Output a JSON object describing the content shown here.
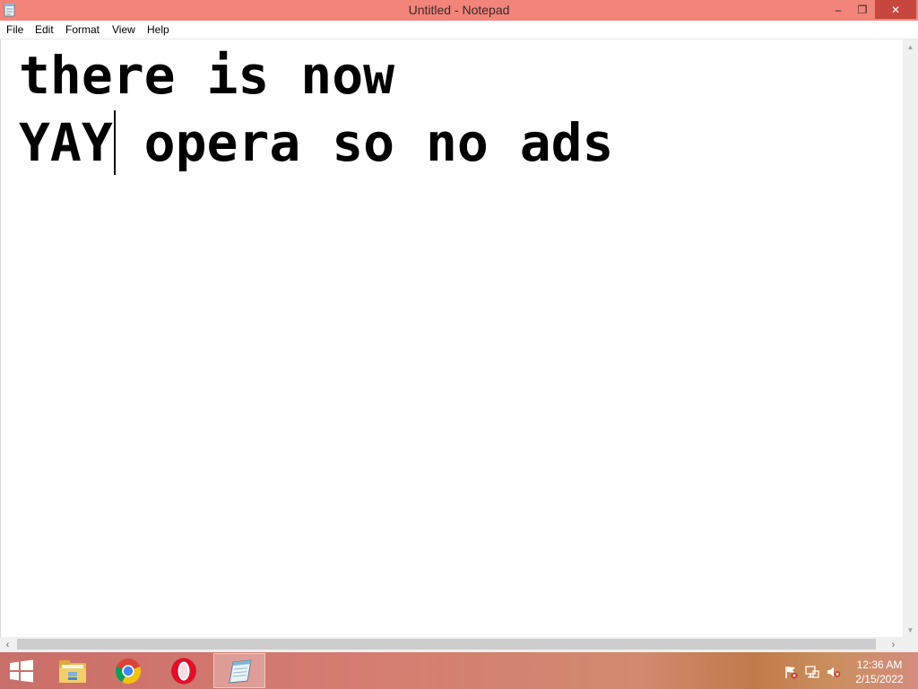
{
  "window": {
    "title": "Untitled - Notepad",
    "controls": {
      "minimize": "–",
      "maximize": "❐",
      "close": "✕"
    }
  },
  "menu": {
    "file": "File",
    "edit": "Edit",
    "format": "Format",
    "view": "View",
    "help": "Help"
  },
  "editor": {
    "line1": "there is now",
    "line2_before_caret": "YAY",
    "line2_after_caret": " opera so no ads"
  },
  "scrollbars": {
    "vertical_up": "▲",
    "vertical_down": "▼",
    "horizontal_left": "‹",
    "horizontal_right": "›"
  },
  "taskbar": {
    "items": [
      {
        "name": "start-button",
        "icon": "windows-logo-icon"
      },
      {
        "name": "file-explorer",
        "icon": "folder-icon"
      },
      {
        "name": "google-chrome",
        "icon": "chrome-icon"
      },
      {
        "name": "opera",
        "icon": "opera-icon"
      },
      {
        "name": "notepad",
        "icon": "notepad-icon",
        "active": true
      }
    ],
    "tray_icons": [
      "action-center-flag-icon",
      "network-icon",
      "volume-muted-icon"
    ],
    "clock": {
      "time": "12:36 AM",
      "date": "2/15/2022"
    }
  },
  "colors": {
    "titlebar": "#f3847a",
    "close_button": "#c7463d",
    "taskbar": "#d67d72"
  }
}
